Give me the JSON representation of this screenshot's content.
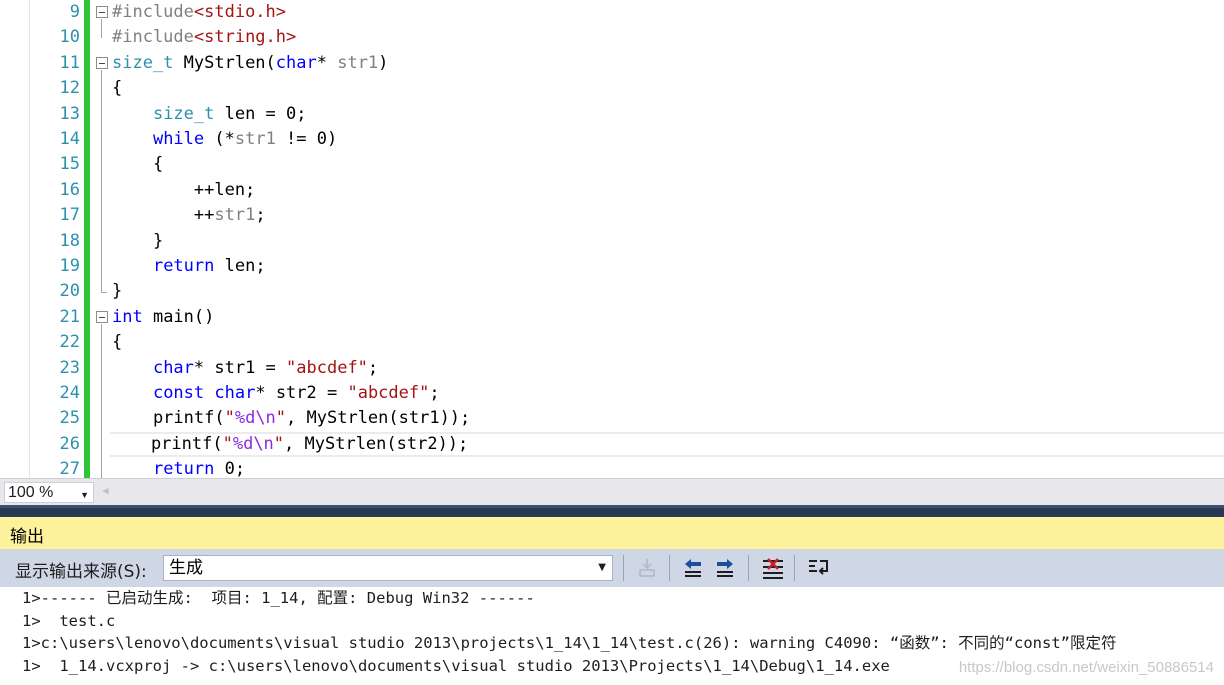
{
  "editor": {
    "line_numbers": [
      "9",
      "10",
      "11",
      "12",
      "13",
      "14",
      "15",
      "16",
      "17",
      "18",
      "19",
      "20",
      "21",
      "22",
      "23",
      "24",
      "25",
      "26",
      "27"
    ]
  },
  "code": {
    "l9": {
      "a": "#include",
      "b": "<stdio.h>"
    },
    "l10": {
      "a": "#include",
      "b": "<string.h>"
    },
    "l11": {
      "t": "size_t",
      "b": " MyStrlen(",
      "k": "char",
      "c": "* ",
      "p": "str1",
      "d": ")"
    },
    "l12": {
      "a": "{"
    },
    "l13": {
      "i": "    ",
      "t": "size_t",
      "b": " len = 0;"
    },
    "l14": {
      "i": "    ",
      "k": "while",
      "b": " (*",
      "p": "str1",
      "c": " != 0)"
    },
    "l15": {
      "a": "    {"
    },
    "l16": {
      "a": "        ++len;"
    },
    "l17": {
      "i": "        ++",
      "p": "str1",
      "c": ";"
    },
    "l18": {
      "a": "    }"
    },
    "l19": {
      "i": "    ",
      "k": "return",
      "b": " len;"
    },
    "l20": {
      "a": "}"
    },
    "l21": {
      "k": "int",
      "b": " main()"
    },
    "l22": {
      "a": "{"
    },
    "l23": {
      "i": "    ",
      "k": "char",
      "b": "* str1 = ",
      "s": "\"abcdef\"",
      "c": ";"
    },
    "l24": {
      "i": "    ",
      "k": "const",
      "b": " ",
      "k2": "char",
      "c": "* str2 = ",
      "s": "\"abcdef\"",
      "d": ";"
    },
    "l25": {
      "i": "    printf(",
      "s": "\"",
      "e": "%d\\n",
      "s2": "\"",
      "c": ", MyStrlen(str1));"
    },
    "l26": {
      "i": "    printf(",
      "s": "\"",
      "e": "%d\\n",
      "s2": "\"",
      "c": ", MyStrlen(str2));"
    },
    "l27": {
      "i": "    ",
      "k": "return",
      "b": " 0;"
    }
  },
  "statusbar": {
    "zoom": "100 %",
    "zoom_arrow": "▼",
    "scroll_left": "◀"
  },
  "output": {
    "title": "输出",
    "source_label": "显示输出来源(S):",
    "source_value": "生成",
    "source_arrow": "▼",
    "lines": [
      "1>------ 已启动生成:  项目: 1_14, 配置: Debug Win32 ------",
      "1>  test.c",
      "1>c:\\users\\lenovo\\documents\\visual studio 2013\\projects\\1_14\\1_14\\test.c(26): warning C4090: “函数”: 不同的“const”限定符",
      "1>  1_14.vcxproj -> c:\\users\\lenovo\\documents\\visual studio 2013\\Projects\\1_14\\Debug\\1_14.exe"
    ],
    "watermark": "https://blog.csdn.net/weixin_50886514"
  },
  "icons": {
    "fold": "collapse-minus-icon",
    "toolbar": [
      "find-message-in-code-icon",
      "go-to-previous-message-icon",
      "go-to-next-message-icon",
      "clear-all-icon",
      "toggle-word-wrap-icon"
    ]
  },
  "colors": {
    "keyword": "#0000ff",
    "type": "#2b91af",
    "string": "#a31515",
    "preprocessor": "#808080",
    "change_bar": "#2fc338",
    "output_title_bg": "#fff29d",
    "toolbar_bg": "#cfd6e5",
    "splitter": "#293955"
  }
}
